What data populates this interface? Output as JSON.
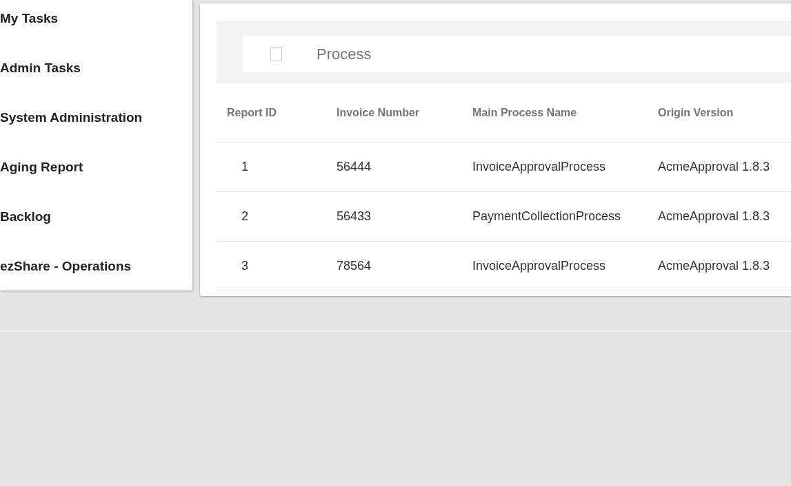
{
  "sidebar": {
    "items": [
      {
        "label": "My Tasks"
      },
      {
        "label": "Admin Tasks"
      },
      {
        "label": "System Administration"
      },
      {
        "label": "Aging Report"
      },
      {
        "label": "Backlog"
      },
      {
        "label": "ezShare - Operations"
      }
    ]
  },
  "toolbar": {
    "select_all": {
      "checked": false
    },
    "title": "Process"
  },
  "table": {
    "columns": [
      "Report ID",
      "Invoice Number",
      "Main Process Name",
      "Origin Version"
    ],
    "rows": [
      [
        "1",
        "56444",
        "InvoiceApprovalProcess",
        "AcmeApproval 1.8.3"
      ],
      [
        "2",
        "56433",
        "PaymentCollectionProcess",
        "AcmeApproval 1.8.3"
      ],
      [
        "3",
        "78564",
        "InvoiceApprovalProcess",
        "AcmeApproval 1.8.3"
      ]
    ]
  }
}
